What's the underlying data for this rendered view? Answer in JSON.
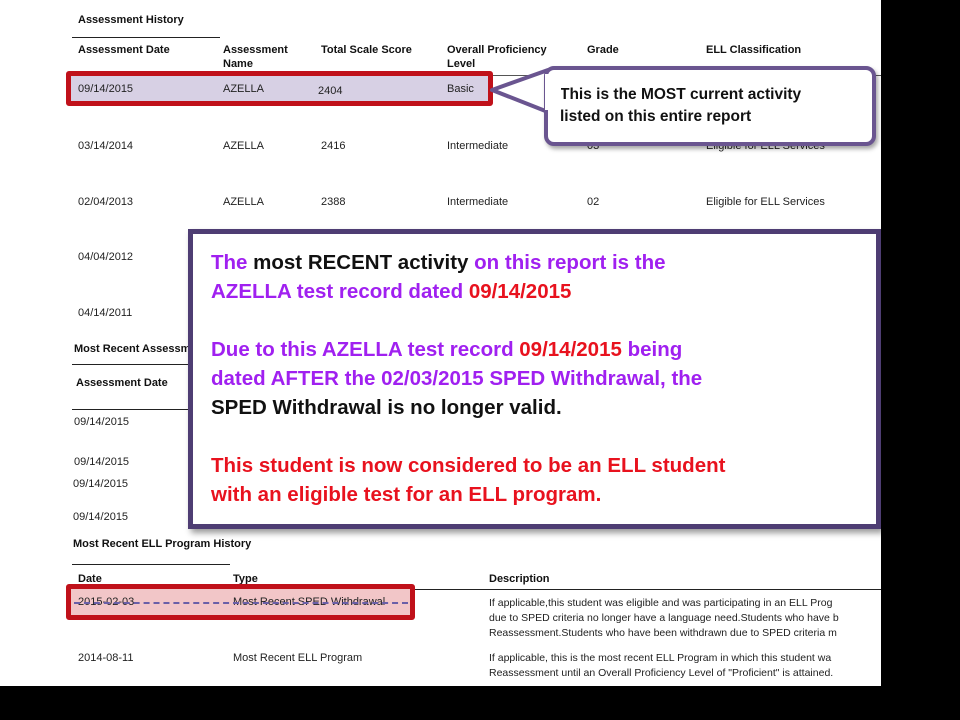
{
  "assessment_history": {
    "title": "Assessment History",
    "headers": [
      "Assessment Date",
      "Assessment Name",
      "Total Scale Score",
      "Overall Proficiency Level",
      "Grade",
      "ELL Classification"
    ],
    "rows": [
      [
        "09/14/2015",
        "AZELLA",
        "2404",
        "Basic",
        "",
        ""
      ],
      [
        "03/14/2014",
        "AZELLA",
        "2416",
        "Intermediate",
        "03",
        "Eligible for ELL Services"
      ],
      [
        "02/04/2013",
        "AZELLA",
        "2388",
        "Intermediate",
        "02",
        "Eligible for ELL Services"
      ],
      [
        "04/04/2012",
        "",
        "",
        "",
        "",
        ""
      ],
      [
        "04/14/2011",
        "",
        "",
        "",
        "",
        ""
      ]
    ]
  },
  "most_recent_assessment": {
    "title": "Most Recent Assessm",
    "header": "Assessment Date",
    "dates": [
      "09/14/2015",
      "09/14/2015",
      "09/14/2015",
      "09/14/2015"
    ]
  },
  "ell_program_history": {
    "title": "Most Recent ELL Program History",
    "headers": [
      "Date",
      "Type",
      "Description"
    ],
    "rows": [
      {
        "date": "2015-02-03",
        "type": "Most Recent SPED Withdrawal",
        "desc": [
          "If applicable,this student was eligible and was participating in an ELL Prog",
          "due to SPED criteria no longer have a language need.Students who have b",
          "Reassessment.Students who have been withdrawn due to SPED criteria m"
        ]
      },
      {
        "date": "2014-08-11",
        "type": "Most Recent ELL Program",
        "desc": [
          "If applicable, this is the most recent ELL Program in which this student wa",
          "Reassessment until an Overall Proficiency Level of \"Proficient\" is attained."
        ]
      }
    ]
  },
  "callout_small": {
    "line1": "This is the MOST current activity",
    "line2": "listed on this entire report"
  },
  "callout_big": {
    "p1": {
      "a": "The ",
      "b": "most RECENT activity",
      "c": " on this report is the"
    },
    "p1_line2": {
      "a": "AZELLA test record dated ",
      "b": "09/14/2015"
    },
    "p2_line1": {
      "a": "Due to this AZELLA test record ",
      "b": "09/14/2015",
      "c": " being"
    },
    "p2_line2": "dated AFTER the 02/03/2015 SPED Withdrawal, the",
    "p2_line3": {
      "a": "SPED",
      "b": " Withdrawal is no longer valid."
    },
    "p3_line1": "This student is now considered to be an ELL student",
    "p3_line2": "with an eligible test for an ELL program."
  },
  "colors": {
    "accent_purple": "#a020f0",
    "highlight_red": "#e8121e",
    "box_red": "#c0111a",
    "callout_border": "#4e3d73"
  }
}
